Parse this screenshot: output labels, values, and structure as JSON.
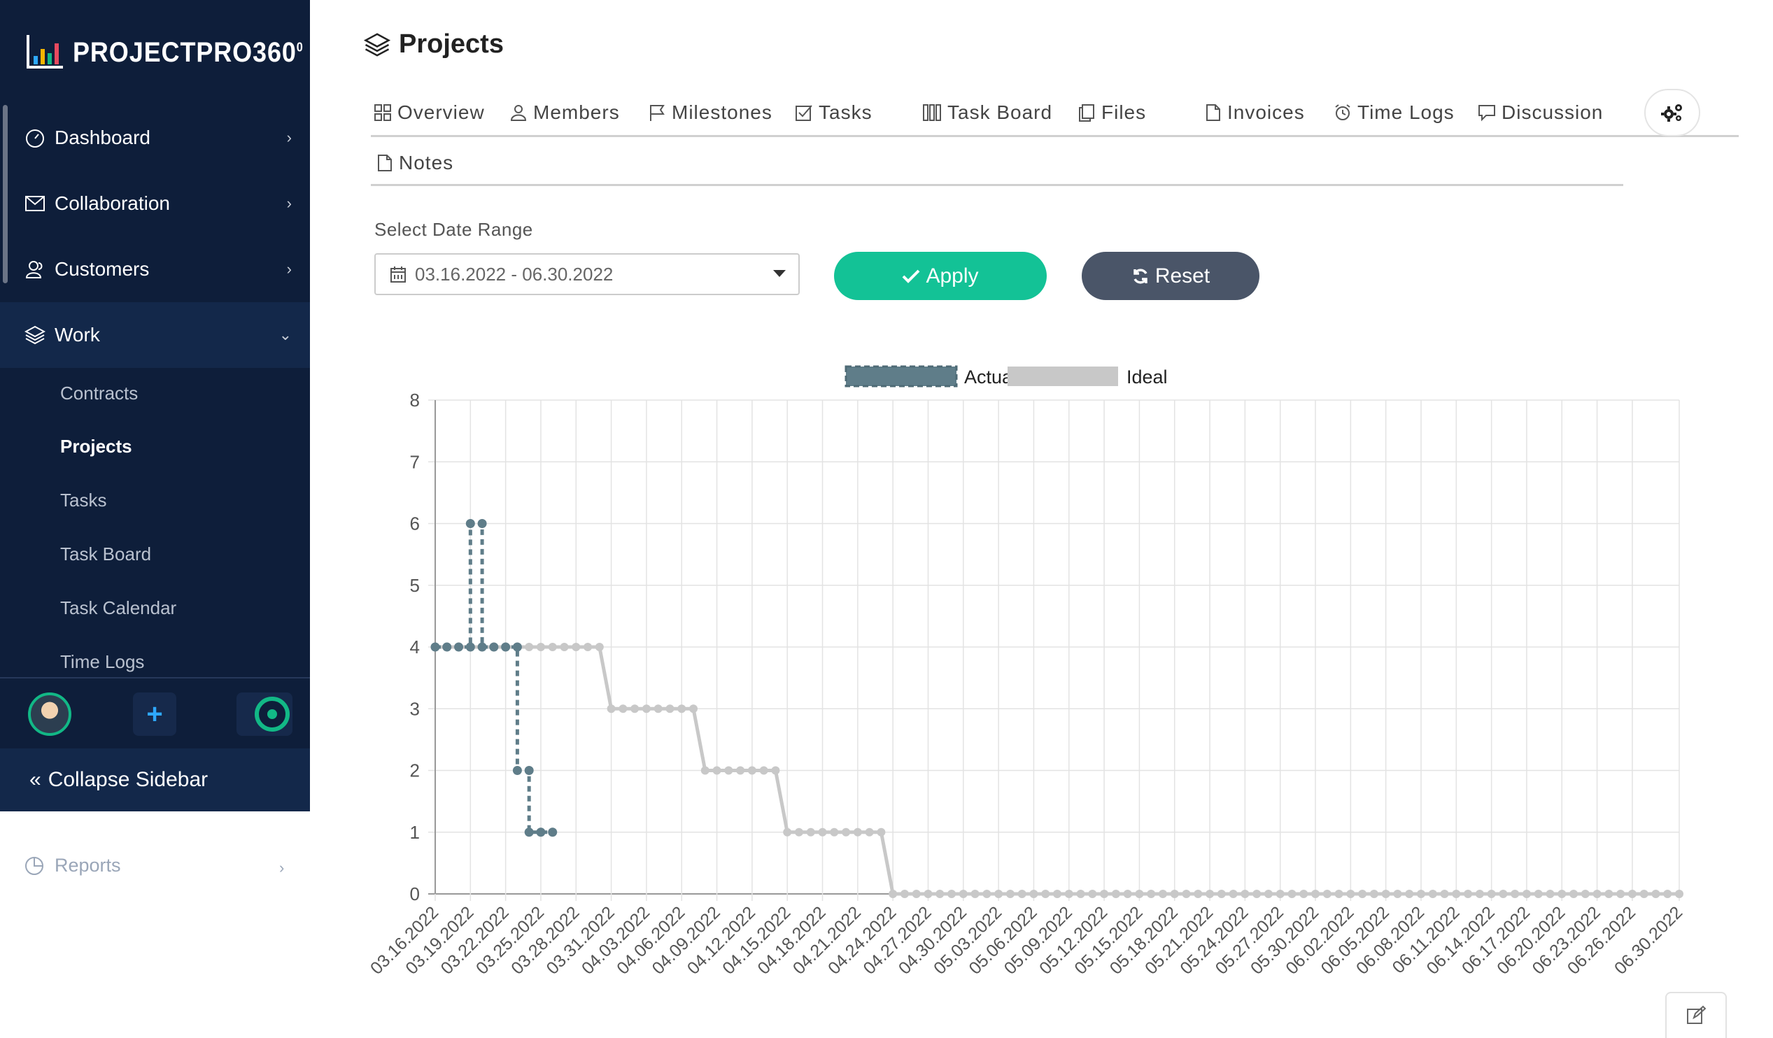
{
  "app": {
    "logo_text": "PROJECTPRO360",
    "logo_sup": "0"
  },
  "sidebar": {
    "items": [
      {
        "label": "Dashboard",
        "icon": "gauge-icon"
      },
      {
        "label": "Collaboration",
        "icon": "mail-icon"
      },
      {
        "label": "Customers",
        "icon": "users-icon"
      },
      {
        "label": "Work",
        "icon": "layers-icon"
      }
    ],
    "work_sub": [
      "Contracts",
      "Projects",
      "Tasks",
      "Task Board",
      "Task Calendar",
      "Time Logs"
    ],
    "current_sub": "Projects",
    "collapse_label": "Collapse Sidebar",
    "reports_label": "Reports"
  },
  "page": {
    "title": "Projects"
  },
  "tabs": [
    {
      "label": "Overview",
      "icon": "grid-icon"
    },
    {
      "label": "Members",
      "icon": "user-icon"
    },
    {
      "label": "Milestones",
      "icon": "flag-icon"
    },
    {
      "label": "Tasks",
      "icon": "checkbox-icon"
    },
    {
      "label": "Task Board",
      "icon": "columns-icon"
    },
    {
      "label": "Files",
      "icon": "files-icon"
    },
    {
      "label": "Invoices",
      "icon": "file-icon"
    },
    {
      "label": "Time Logs",
      "icon": "alarm-icon"
    },
    {
      "label": "Discussion",
      "icon": "comment-icon"
    },
    {
      "label": "Notes",
      "icon": "file-icon"
    }
  ],
  "filter": {
    "label": "Select Date Range",
    "value": "03.16.2022 - 06.30.2022",
    "apply_label": "Apply",
    "reset_label": "Reset"
  },
  "colors": {
    "sidebar": "#0e1e3a",
    "apply": "#13c296",
    "reset": "#4a5568",
    "actual": "#5f7d89",
    "ideal": "#c8c8c8"
  },
  "chart_data": {
    "type": "line",
    "legend_placement": "top",
    "ylim": [
      0,
      8
    ],
    "yticks": [
      0,
      1,
      2,
      3,
      4,
      5,
      6,
      7,
      8
    ],
    "x_start": "03.16.2022",
    "x_end": "06.30.2022",
    "x_tick_labels": [
      "03.16.2022",
      "03.19.2022",
      "03.22.2022",
      "03.25.2022",
      "03.28.2022",
      "03.31.2022",
      "04.03.2022",
      "04.06.2022",
      "04.09.2022",
      "04.12.2022",
      "04.15.2022",
      "04.18.2022",
      "04.21.2022",
      "04.24.2022",
      "04.27.2022",
      "04.30.2022",
      "05.03.2022",
      "05.06.2022",
      "05.09.2022",
      "05.12.2022",
      "05.15.2022",
      "05.18.2022",
      "05.21.2022",
      "05.24.2022",
      "05.27.2022",
      "05.30.2022",
      "06.02.2022",
      "06.05.2022",
      "06.08.2022",
      "06.11.2022",
      "06.14.2022",
      "06.17.2022",
      "06.20.2022",
      "06.23.2022",
      "06.26.2022",
      "06.30.2022"
    ],
    "series": [
      {
        "name": "Actual",
        "style": "dashed",
        "points": [
          [
            "03.16.2022",
            4
          ],
          [
            "03.17.2022",
            4
          ],
          [
            "03.18.2022",
            4
          ],
          [
            "03.19.2022",
            4
          ],
          [
            "03.19.2022",
            6
          ],
          [
            "03.20.2022",
            6
          ],
          [
            "03.20.2022",
            4
          ],
          [
            "03.21.2022",
            4
          ],
          [
            "03.22.2022",
            4
          ],
          [
            "03.23.2022",
            4
          ],
          [
            "03.23.2022",
            2
          ],
          [
            "03.24.2022",
            2
          ],
          [
            "03.24.2022",
            1
          ],
          [
            "03.25.2022",
            1
          ],
          [
            "03.26.2022",
            1
          ]
        ]
      },
      {
        "name": "Ideal",
        "style": "solid",
        "steps": [
          {
            "from": "03.16.2022",
            "to": "03.30.2022",
            "value": 4
          },
          {
            "from": "03.31.2022",
            "to": "04.07.2022",
            "value": 3
          },
          {
            "from": "04.08.2022",
            "to": "04.14.2022",
            "value": 2
          },
          {
            "from": "04.15.2022",
            "to": "04.23.2022",
            "value": 1
          },
          {
            "from": "04.24.2022",
            "to": "06.30.2022",
            "value": 0
          }
        ]
      }
    ]
  }
}
